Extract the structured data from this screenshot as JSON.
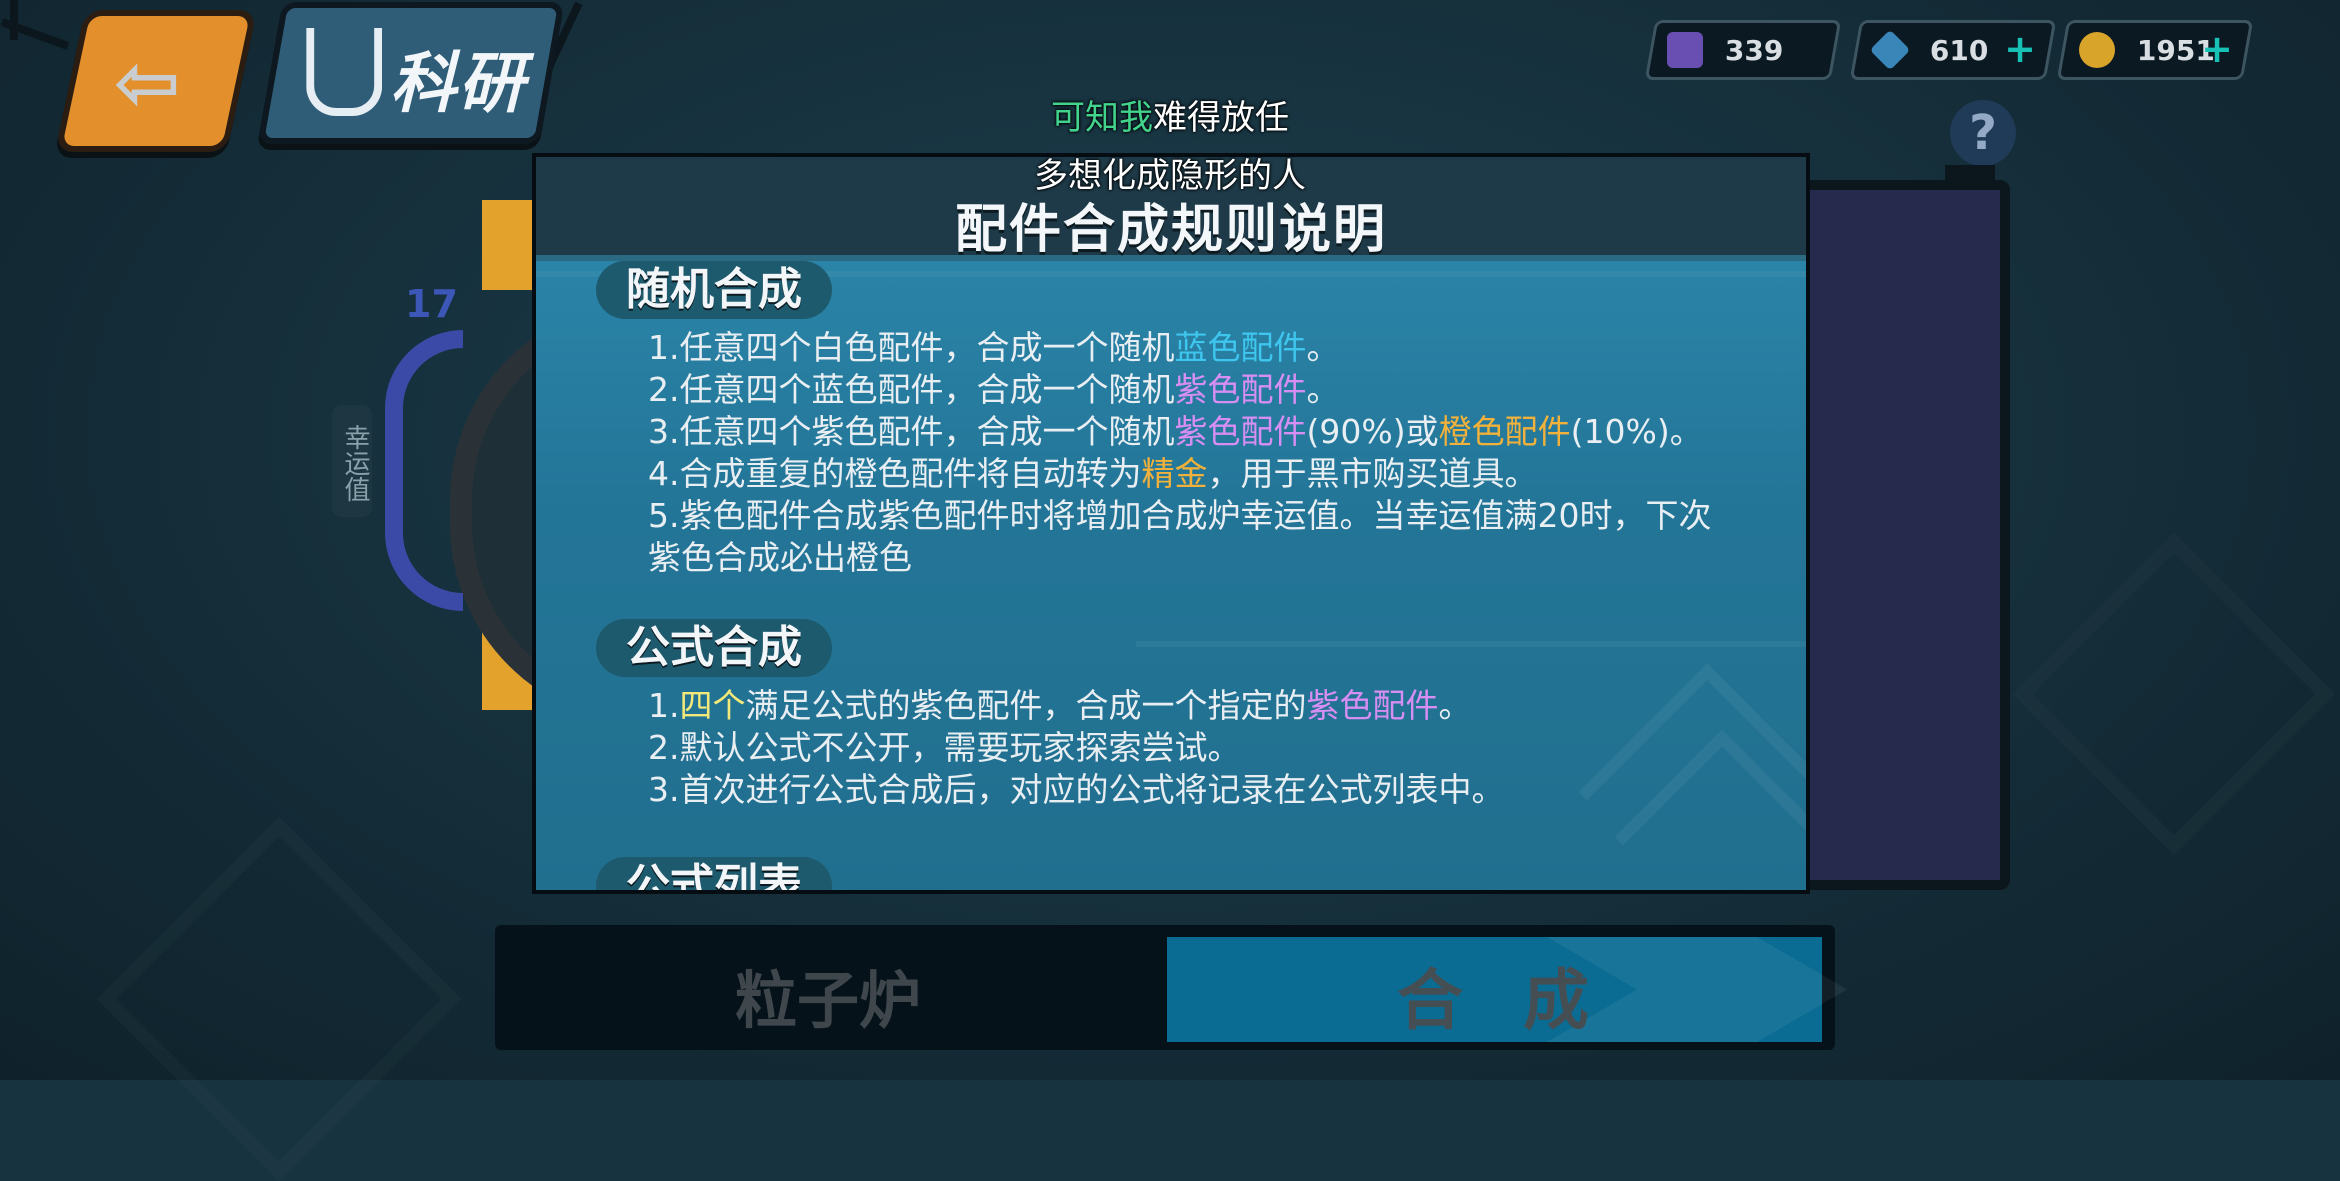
{
  "header": {
    "back_icon": "back-arrow-icon",
    "title": "科研",
    "title_icon": "flask-icon"
  },
  "currencies": [
    {
      "icon": "purple-cube-icon",
      "value": "339",
      "color": "#6a4fb3",
      "has_plus": false
    },
    {
      "icon": "blue-gem-icon",
      "value": "610",
      "color": "#3a86b8",
      "has_plus": true
    },
    {
      "icon": "gold-coin-icon",
      "value": "1951",
      "color": "#d8a42a",
      "has_plus": true
    }
  ],
  "plus_label": "+",
  "help_label": "?",
  "lucky": {
    "value": "17",
    "label": "幸运值"
  },
  "tabs": {
    "left": "粒子炉",
    "right": "合成"
  },
  "lyric": {
    "line1_highlight": "可知我",
    "line1_rest": "难得放任",
    "line2": "多想化成隐形的人"
  },
  "modal": {
    "title": "配件合成规则说明",
    "sections": [
      {
        "title": "随机合成",
        "rules": [
          [
            {
              "t": "1.任意四个白色配件，合成一个随机"
            },
            {
              "t": "蓝色配件",
              "c": "blue"
            },
            {
              "t": "。"
            }
          ],
          [
            {
              "t": "2.任意四个蓝色配件，合成一个随机"
            },
            {
              "t": "紫色配件",
              "c": "purple"
            },
            {
              "t": "。"
            }
          ],
          [
            {
              "t": "3.任意四个紫色配件，合成一个随机"
            },
            {
              "t": "紫色配件",
              "c": "purple"
            },
            {
              "t": "(90%)或"
            },
            {
              "t": "橙色配件",
              "c": "orange"
            },
            {
              "t": "(10%)。"
            }
          ],
          [
            {
              "t": "4.合成重复的橙色配件将自动转为"
            },
            {
              "t": "精金",
              "c": "orange"
            },
            {
              "t": "，用于黑市购买道具。"
            }
          ],
          [
            {
              "t": "5.紫色配件合成紫色配件时将增加合成炉幸运值。当幸运值满20时，下次"
            }
          ],
          [
            {
              "t": "  紫色合成必出橙色"
            }
          ]
        ]
      },
      {
        "title": "公式合成",
        "rules": [
          [
            {
              "t": "1."
            },
            {
              "t": "四个",
              "c": "yellow"
            },
            {
              "t": "满足公式的紫色配件，合成一个指定的"
            },
            {
              "t": "紫色配件",
              "c": "purple"
            },
            {
              "t": "。"
            }
          ],
          [
            {
              "t": "2.默认公式不公开，需要玩家探索尝试。"
            }
          ],
          [
            {
              "t": "3.首次进行公式合成后，对应的公式将记录在公式列表中。"
            }
          ]
        ]
      },
      {
        "title": "公式列表",
        "rules": []
      }
    ]
  }
}
